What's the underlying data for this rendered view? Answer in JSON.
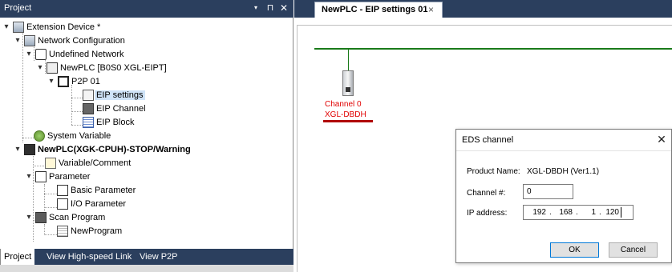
{
  "project_pane": {
    "title": "Project",
    "controls": [
      "▾",
      "⊓",
      "✕"
    ],
    "tree": [
      {
        "label": "Extension Device *",
        "icon": "extension-device-icon"
      },
      {
        "label": "Network Configuration",
        "icon": "network-config-icon"
      },
      {
        "label": "Undefined Network",
        "icon": "network-folder-icon"
      },
      {
        "label": "NewPLC [B0S0 XGL-EIPT]",
        "icon": "plc-module-icon"
      },
      {
        "label": "P2P 01",
        "icon": "p2p-icon"
      },
      {
        "label": "EIP settings",
        "icon": "eip-settings-icon",
        "selected": true
      },
      {
        "label": "EIP Channel",
        "icon": "eip-channel-icon"
      },
      {
        "label": "EIP Block",
        "icon": "eip-block-icon"
      },
      {
        "label": "System Variable",
        "icon": "system-variable-icon"
      },
      {
        "label": "NewPLC(XGK-CPUH)-STOP/Warning",
        "icon": "plc-cpu-icon",
        "bold": true
      },
      {
        "label": "Variable/Comment",
        "icon": "variable-comment-icon"
      },
      {
        "label": "Parameter",
        "icon": "parameter-icon"
      },
      {
        "label": "Basic Parameter",
        "icon": "basic-parameter-icon"
      },
      {
        "label": "I/O Parameter",
        "icon": "io-parameter-icon"
      },
      {
        "label": "Scan Program",
        "icon": "scan-program-icon"
      },
      {
        "label": "NewProgram",
        "icon": "program-icon"
      }
    ],
    "tabs": [
      "Project",
      "View High-speed Link",
      "View P2P"
    ]
  },
  "editor": {
    "tab_label": "NewPLC - EIP settings 01",
    "tab_close": "×",
    "device": {
      "channel_label": "Channel 0",
      "name": "XGL-DBDH"
    }
  },
  "dialog": {
    "title": "EDS channel",
    "close": "✕",
    "product_label": "Product Name:",
    "product_value": "XGL-DBDH (Ver1.1)",
    "channel_label": "Channel #:",
    "channel_value": "0",
    "ip_label": "IP address:",
    "ip_octets": [
      "192",
      "168",
      "1",
      "120"
    ],
    "ok_label": "OK",
    "cancel_label": "Cancel"
  },
  "colors": {
    "pane_header": "#2b3f5e",
    "bus_line": "#1a7a1a",
    "device_label": "#e00000",
    "selection": "#cfe3f7"
  }
}
